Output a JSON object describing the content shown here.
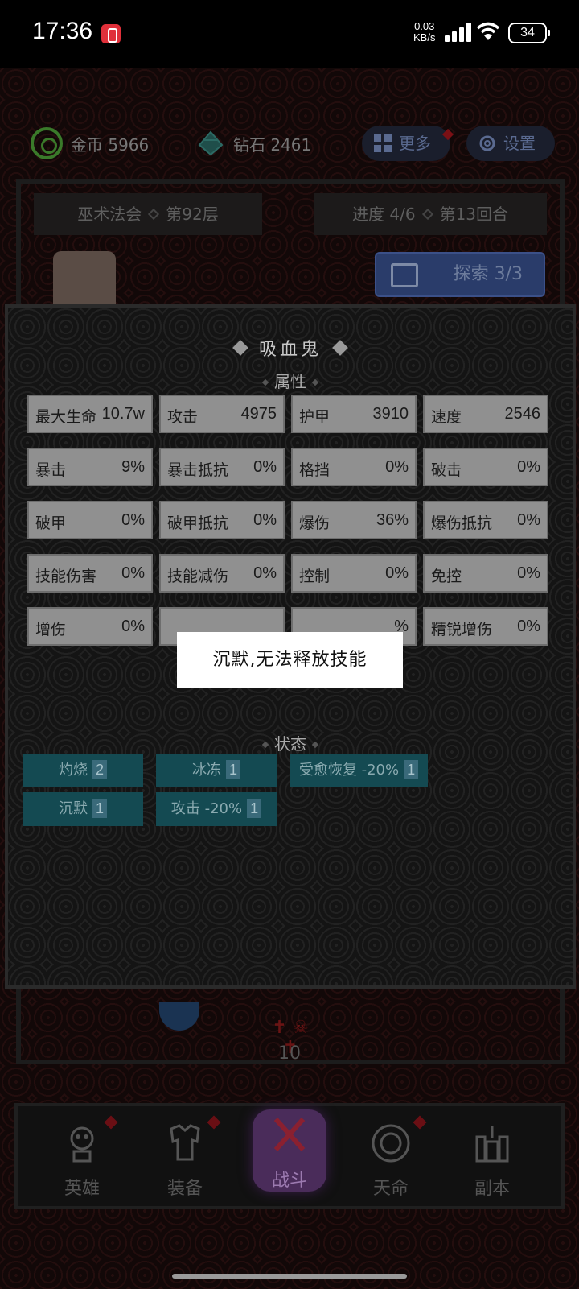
{
  "status_bar": {
    "time": "17:36",
    "net_speed_value": "0.03",
    "net_speed_unit": "KB/s",
    "battery": "34"
  },
  "top": {
    "gold_label": "金币 5966",
    "diamond_label": "钻石 2461",
    "more_label": "更多",
    "settings_label": "设置",
    "dungeon_name": "巫术法会",
    "floor": "第92层",
    "progress": "进度 4/6",
    "round": "第13回合",
    "explore_label": "探索 3/3"
  },
  "battle_counter": "10",
  "modal": {
    "title": "吸血鬼",
    "attributes_label": "属性",
    "status_label": "状态",
    "attributes": [
      [
        {
          "k": "最大生命",
          "v": "10.7w"
        },
        {
          "k": "攻击",
          "v": "4975"
        },
        {
          "k": "护甲",
          "v": "3910"
        },
        {
          "k": "速度",
          "v": "2546"
        }
      ],
      [
        {
          "k": "暴击",
          "v": "9%"
        },
        {
          "k": "暴击抵抗",
          "v": "0%"
        },
        {
          "k": "格挡",
          "v": "0%"
        },
        {
          "k": "破击",
          "v": "0%"
        }
      ],
      [
        {
          "k": "破甲",
          "v": "0%"
        },
        {
          "k": "破甲抵抗",
          "v": "0%"
        },
        {
          "k": "爆伤",
          "v": "36%"
        },
        {
          "k": "爆伤抵抗",
          "v": "0%"
        }
      ],
      [
        {
          "k": "技能伤害",
          "v": "0%"
        },
        {
          "k": "技能减伤",
          "v": "0%"
        },
        {
          "k": "控制",
          "v": "0%"
        },
        {
          "k": "免控",
          "v": "0%"
        }
      ],
      [
        {
          "k": "增伤",
          "v": "0%"
        },
        {
          "k": "",
          "v": ""
        },
        {
          "k": "",
          "v": "%"
        },
        {
          "k": "精锐增伤",
          "v": "0%"
        }
      ]
    ],
    "statuses": [
      {
        "label": "灼烧",
        "count": "2"
      },
      {
        "label": "冰冻",
        "count": "1"
      },
      {
        "label": "受愈恢复 -20%",
        "count": "1"
      },
      {
        "label": "沉默",
        "count": "1"
      },
      {
        "label": "攻击 -20%",
        "count": "1"
      }
    ]
  },
  "toast": "沉默,无法释放技能",
  "nav": [
    {
      "label": "英雄",
      "icon": "hero-icon"
    },
    {
      "label": "装备",
      "icon": "armor-icon"
    },
    {
      "label": "战斗",
      "icon": "crossed-swords-icon"
    },
    {
      "label": "天命",
      "icon": "destiny-icon"
    },
    {
      "label": "副本",
      "icon": "dungeon-icon"
    }
  ],
  "colors": {
    "attr_cell": "#909090",
    "status_tag": "#144a52",
    "explore_button": "#2a3c6a",
    "battle_tab": "#4a2c5a"
  }
}
